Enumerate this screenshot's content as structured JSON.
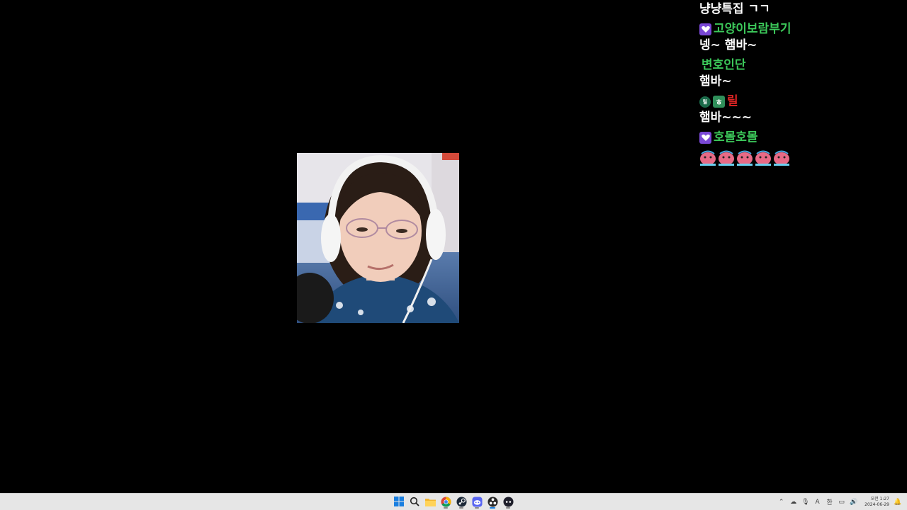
{
  "chat": {
    "messages": [
      {
        "username": "",
        "name_color": "#ffffff",
        "badges": [],
        "text": "냥냥특집 ㄱㄱ"
      },
      {
        "username": "고양이보람부기",
        "name_color": "#3cc85a",
        "badges": [
          "heart-badge-icon"
        ],
        "text": "넹~ 햄바~"
      },
      {
        "username": "변호인단",
        "name_color": "#3cc85a",
        "badges": [],
        "text": "햄바~"
      },
      {
        "username": "릴",
        "name_color": "#e02525",
        "badges": [
          "circle-badge-icon",
          "green-badge-icon"
        ],
        "badge_text": [
          "릴",
          "ㅎ"
        ],
        "text": "햄바~~~"
      },
      {
        "username": "호몰호몰",
        "name_color": "#3cc85a",
        "badges": [
          "heart-badge-icon"
        ],
        "emotes": [
          "pink-creature-emote",
          "pink-creature-emote",
          "pink-creature-emote",
          "pink-creature-emote",
          "pink-creature-emote"
        ]
      }
    ]
  },
  "taskbar": {
    "apps": [
      "windows-start-icon",
      "search-icon",
      "file-explorer-icon",
      "chrome-icon",
      "steam-icon",
      "discord-icon",
      "obs-icon",
      "app-icon"
    ],
    "tray_icons": [
      "chevron-up-icon",
      "cloud-icon",
      "mic-icon",
      "font-icon",
      "language-icon",
      "display-icon",
      "speaker-icon",
      "notification-icon"
    ],
    "ime_label": "A",
    "lang_label": "한",
    "time": "오전 1:27",
    "date": "2024-06-29"
  },
  "colors": {
    "background": "#000000",
    "taskbar": "#e6e6e6",
    "chat_green": "#3cc85a",
    "chat_red": "#e02525",
    "badge_purple": "#7a48d6"
  }
}
